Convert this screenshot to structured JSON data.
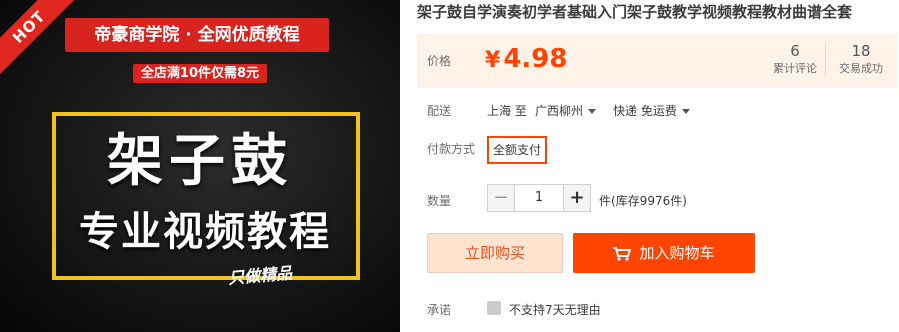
{
  "image": {
    "hot_badge": "HOT",
    "brand_banner": "帝豪商学院 · 全网优质教程",
    "promo": "全店满10件仅需8元",
    "title_main": "架子鼓",
    "title_sub": "专业视频教程",
    "slogan": "只做精品"
  },
  "product": {
    "title": "架子鼓自学演奏初学者基础入门架子鼓教学视频教程教材曲谱全套"
  },
  "price": {
    "label": "价格",
    "currency": "¥",
    "value": "4.98",
    "reviews_count": "6",
    "reviews_label": "累计评论",
    "sold_count": "18",
    "sold_label": "交易成功"
  },
  "shipping": {
    "label": "配送",
    "from": "上海 至",
    "to": "广西柳州",
    "method": "快递 免运费"
  },
  "payment": {
    "label": "付款方式",
    "option": "全额支付"
  },
  "quantity": {
    "label": "数量",
    "minus": "−",
    "value": "1",
    "plus": "+",
    "stock": "件(库存9976件)"
  },
  "actions": {
    "buy_now": "立即购买",
    "add_to_cart": "加入购物车"
  },
  "service": {
    "label": "承诺",
    "text": "不支持7天无理由"
  },
  "colors": {
    "accent": "#ff4400",
    "price_bg": "#fff2e8",
    "gold": "#f2c31b",
    "banner_red": "#d8231f"
  }
}
